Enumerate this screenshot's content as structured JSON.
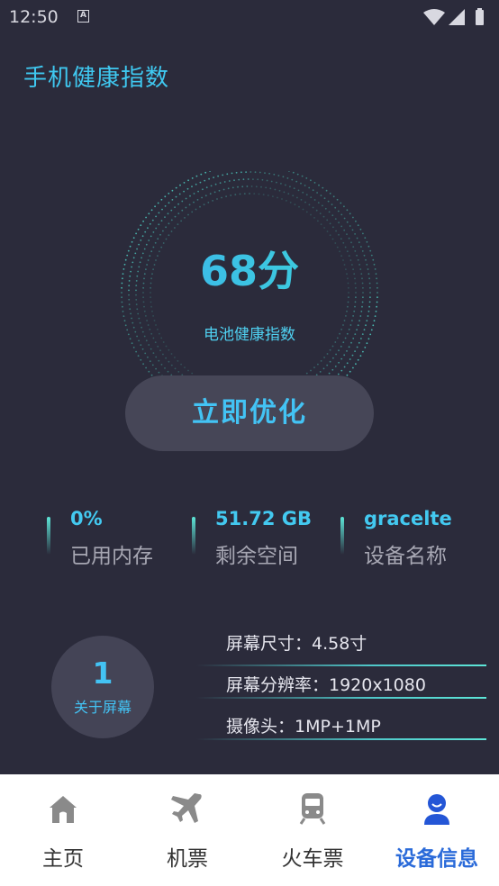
{
  "status": {
    "time": "12:50",
    "notif_letter": "A"
  },
  "header": {
    "title": "手机健康指数"
  },
  "gauge": {
    "score": "68分",
    "label": "电池健康指数",
    "value": 68
  },
  "actions": {
    "optimize_label": "立即优化"
  },
  "stats": [
    {
      "value": "0%",
      "label": "已用内存"
    },
    {
      "value": "51.72 GB",
      "label": "剩余空间"
    },
    {
      "value": "gracelte",
      "label": "设备名称"
    }
  ],
  "screen": {
    "number": "1",
    "label": "关于屏幕",
    "info": [
      "屏幕尺寸：4.58寸",
      "屏幕分辨率：1920x1080",
      "摄像头：1MP+1MP"
    ]
  },
  "tabs": [
    {
      "label": "主页",
      "icon": "home-icon"
    },
    {
      "label": "机票",
      "icon": "airplane-icon"
    },
    {
      "label": "火车票",
      "icon": "train-icon"
    },
    {
      "label": "设备信息",
      "icon": "user-icon"
    }
  ],
  "colors": {
    "accent": "#43c3f4",
    "active_tab": "#2a6ad9",
    "background": "#2b2b3b"
  }
}
